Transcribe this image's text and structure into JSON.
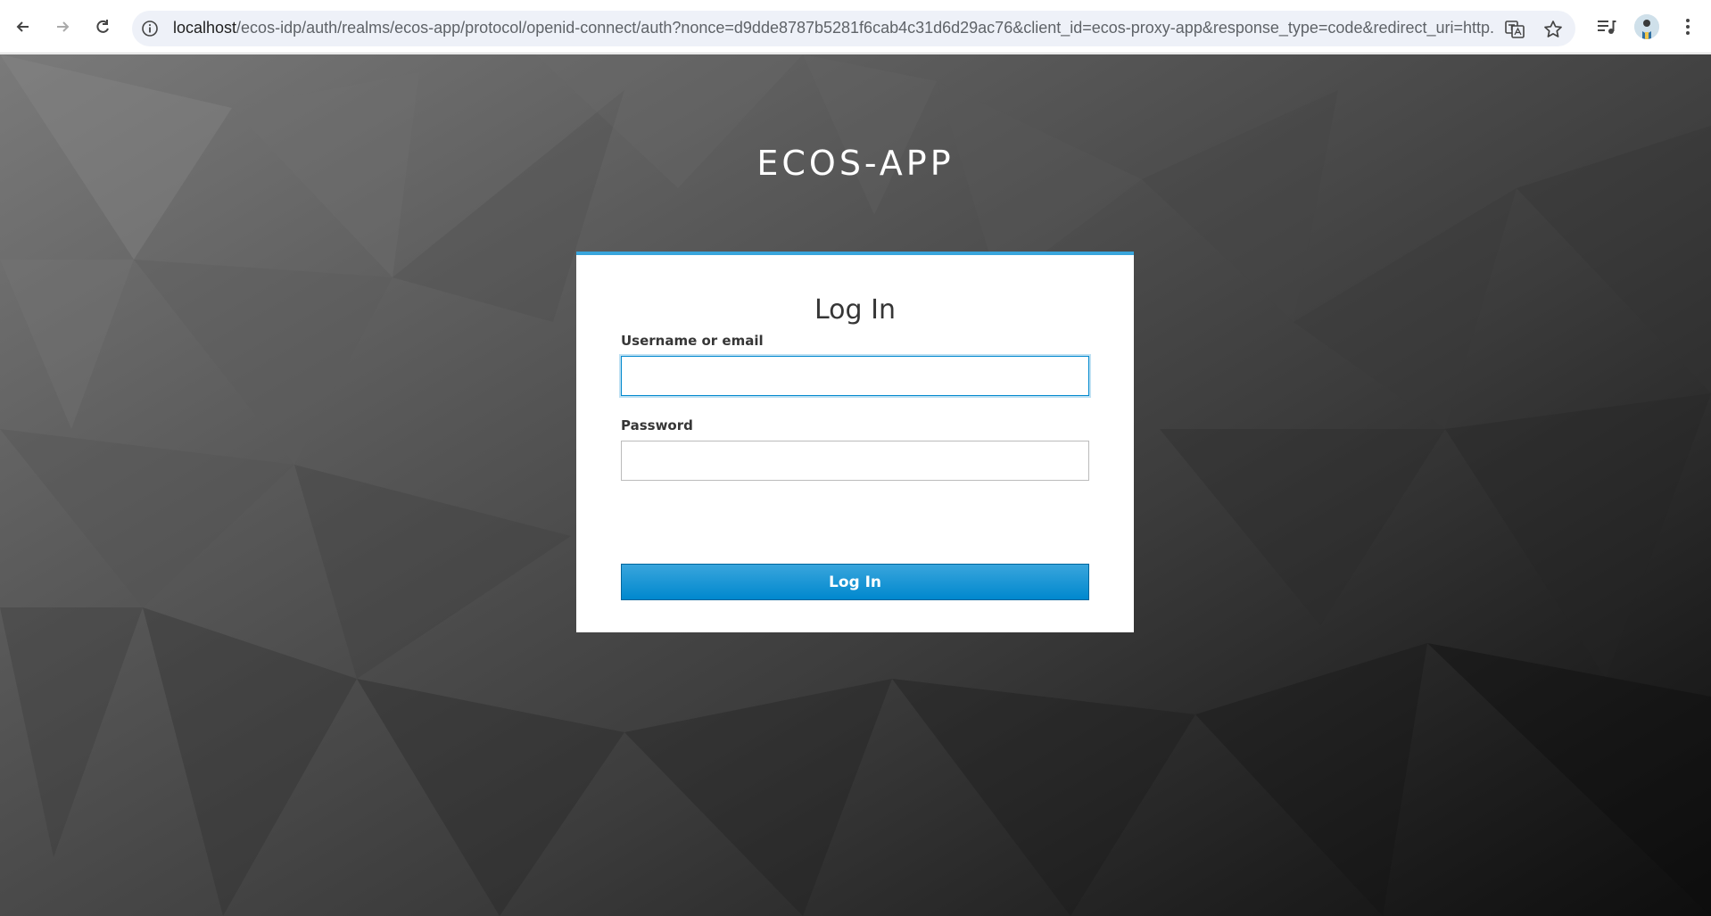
{
  "browser": {
    "url_host": "localhost",
    "url_path": "/ecos-idp/auth/realms/ecos-app/protocol/openid-connect/auth?nonce=d9dde8787b5281f6cab4c31d6d29ac76&client_id=ecos-proxy-app&response_type=code&redirect_uri=http...",
    "icons": [
      "back-icon",
      "forward-icon",
      "reload-icon",
      "site-info-icon",
      "translate-icon",
      "bookmark-star-icon",
      "media-control-icon",
      "profile-avatar",
      "more-menu-icon"
    ]
  },
  "page": {
    "realm_title": "ECOS-APP",
    "card_title": "Log In",
    "username_label": "Username or email",
    "username_value": "",
    "password_label": "Password",
    "password_value": "",
    "login_button": "Log In"
  },
  "colors": {
    "accent": "#0088ce",
    "button_top": "#39a5dc",
    "card_bg": "#ffffff"
  }
}
